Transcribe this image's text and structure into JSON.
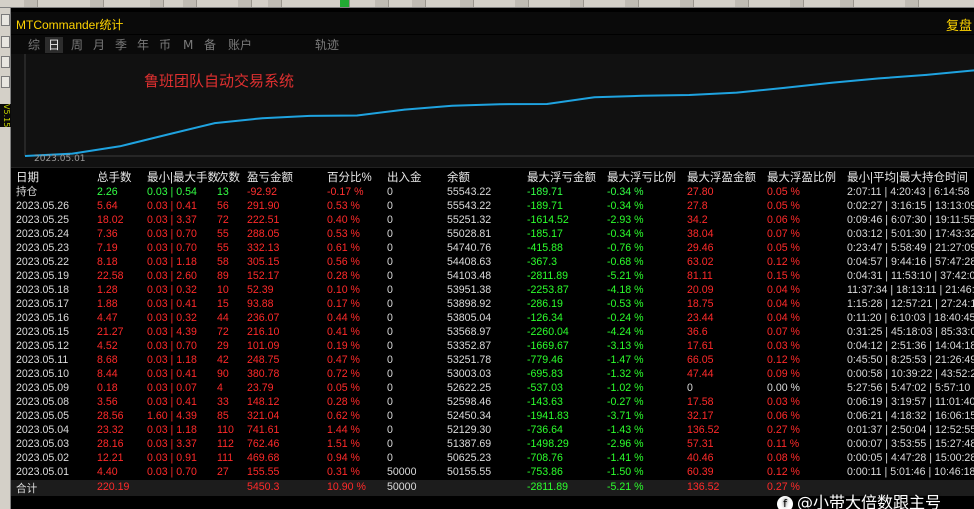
{
  "window": {
    "title": "MTCommander统计",
    "right_button": "复盘",
    "side_label": "V5.15"
  },
  "tabs": [
    {
      "label": "综",
      "active": false
    },
    {
      "label": "日",
      "active": true
    },
    {
      "label": "周",
      "active": false
    },
    {
      "label": "月",
      "active": false
    },
    {
      "label": "季",
      "active": false
    },
    {
      "label": "年",
      "active": false
    },
    {
      "label": "币",
      "active": false
    },
    {
      "label": "M",
      "active": false
    },
    {
      "label": "备",
      "active": false
    },
    {
      "label": "账户",
      "active": false
    },
    {
      "label": "轨迹",
      "active": false
    }
  ],
  "chart": {
    "title": "鲁班团队自动交易系统",
    "start_date": "2023.05.01",
    "line_color": "#1fa3e0",
    "values": [
      50155.55,
      50625.23,
      51387.69,
      52129.3,
      52450.34,
      52598.46,
      52622.25,
      53003.03,
      53251.78,
      53352.87,
      53368.97,
      53805.04,
      53898.92,
      53951.38,
      54103.48,
      54408.63,
      54740.76,
      55028.81,
      55251.32,
      55543.22
    ]
  },
  "table": {
    "headers": [
      "日期",
      "总手数",
      "最小|最大手数",
      "次数",
      "盈亏金额",
      "百分比%",
      "出入金",
      "余额",
      "最大浮亏金额",
      "最大浮亏比例",
      "最大浮盈金额",
      "最大浮盈比例",
      "最小|平均|最大持仓时间"
    ],
    "position": [
      "持仓",
      "2.26",
      "0.03 | 0.54",
      "13",
      "-92.92",
      "-0.17 %",
      "0",
      "55543.22",
      "-189.71",
      "-0.34 %",
      "27.80",
      "0.05 %",
      "2:07:11 | 4:20:43 | 6:14:58"
    ],
    "rows": [
      [
        "2023.05.26",
        "5.64",
        "0.03 | 0.41",
        "56",
        "291.90",
        "0.53 %",
        "0",
        "55543.22",
        "-189.71",
        "-0.34 %",
        "27.8",
        "0.05 %",
        "0:02:27 | 3:16:15 | 13:13:09"
      ],
      [
        "2023.05.25",
        "18.02",
        "0.03 | 3.37",
        "72",
        "222.51",
        "0.40 %",
        "0",
        "55251.32",
        "-1614.52",
        "-2.93 %",
        "34.2",
        "0.06 %",
        "0:09:46 | 6:07:30 | 19:11:55"
      ],
      [
        "2023.05.24",
        "7.36",
        "0.03 | 0.70",
        "55",
        "288.05",
        "0.53 %",
        "0",
        "55028.81",
        "-185.17",
        "-0.34 %",
        "38.04",
        "0.07 %",
        "0:03:12 | 5:01:30 | 17:43:32"
      ],
      [
        "2023.05.23",
        "7.19",
        "0.03 | 0.70",
        "55",
        "332.13",
        "0.61 %",
        "0",
        "54740.76",
        "-415.88",
        "-0.76 %",
        "29.46",
        "0.05 %",
        "0:23:47 | 5:58:49 | 21:27:09"
      ],
      [
        "2023.05.22",
        "8.18",
        "0.03 | 1.18",
        "58",
        "305.15",
        "0.56 %",
        "0",
        "54408.63",
        "-367.3",
        "-0.68 %",
        "63.02",
        "0.12 %",
        "0:04:57 | 9:44:16 | 57:47:28"
      ],
      [
        "2023.05.19",
        "22.58",
        "0.03 | 2.60",
        "89",
        "152.17",
        "0.28 %",
        "0",
        "54103.48",
        "-2811.89",
        "-5.21 %",
        "81.11",
        "0.15 %",
        "0:04:31 | 11:53:10 | 37:42:0"
      ],
      [
        "2023.05.18",
        "1.28",
        "0.03 | 0.32",
        "10",
        "52.39",
        "0.10 %",
        "0",
        "53951.38",
        "-2253.87",
        "-4.18 %",
        "20.09",
        "0.04 %",
        "11:37:34 | 18:13:11 | 21:46:0"
      ],
      [
        "2023.05.17",
        "1.88",
        "0.03 | 0.41",
        "15",
        "93.88",
        "0.17 %",
        "0",
        "53898.92",
        "-286.19",
        "-0.53 %",
        "18.75",
        "0.04 %",
        "1:15:28 | 12:57:21 | 27:24:1"
      ],
      [
        "2023.05.16",
        "4.47",
        "0.03 | 0.32",
        "44",
        "236.07",
        "0.44 %",
        "0",
        "53805.04",
        "-126.34",
        "-0.24 %",
        "23.44",
        "0.04 %",
        "0:11:20 | 6:10:03 | 18:40:45"
      ],
      [
        "2023.05.15",
        "21.27",
        "0.03 | 4.39",
        "72",
        "216.10",
        "0.41 %",
        "0",
        "53568.97",
        "-2260.04",
        "-4.24 %",
        "36.6",
        "0.07 %",
        "0:31:25 | 45:18:03 | 85:33:0"
      ],
      [
        "2023.05.12",
        "4.52",
        "0.03 | 0.70",
        "29",
        "101.09",
        "0.19 %",
        "0",
        "53352.87",
        "-1669.67",
        "-3.13 %",
        "17.61",
        "0.03 %",
        "0:04:12 | 2:51:36 | 14:04:18"
      ],
      [
        "2023.05.11",
        "8.68",
        "0.03 | 1.18",
        "42",
        "248.75",
        "0.47 %",
        "0",
        "53251.78",
        "-779.46",
        "-1.47 %",
        "66.05",
        "0.12 %",
        "0:45:50 | 8:25:53 | 21:26:49"
      ],
      [
        "2023.05.10",
        "8.44",
        "0.03 | 0.41",
        "90",
        "380.78",
        "0.72 %",
        "0",
        "53003.03",
        "-695.83",
        "-1.32 %",
        "47.44",
        "0.09 %",
        "0:00:58 | 10:39:22 | 43:52:2"
      ],
      [
        "2023.05.09",
        "0.18",
        "0.03 | 0.07",
        "4",
        "23.79",
        "0.05 %",
        "0",
        "52622.25",
        "-537.03",
        "-1.02 %",
        "0",
        "0.00 %",
        "5:27:56 | 5:47:02 | 5:57:10"
      ],
      [
        "2023.05.08",
        "3.56",
        "0.03 | 0.41",
        "33",
        "148.12",
        "0.28 %",
        "0",
        "52598.46",
        "-143.63",
        "-0.27 %",
        "17.58",
        "0.03 %",
        "0:06:19 | 3:19:57 | 11:01:40"
      ],
      [
        "2023.05.05",
        "28.56",
        "1.60 | 4.39",
        "85",
        "321.04",
        "0.62 %",
        "0",
        "52450.34",
        "-1941.83",
        "-3.71 %",
        "32.17",
        "0.06 %",
        "0:06:21 | 4:18:32 | 16:06:15"
      ],
      [
        "2023.05.04",
        "23.32",
        "0.03 | 1.18",
        "110",
        "741.61",
        "1.44 %",
        "0",
        "52129.30",
        "-736.64",
        "-1.43 %",
        "136.52",
        "0.27 %",
        "0:01:37 | 2:50:04 | 12:52:55"
      ],
      [
        "2023.05.03",
        "28.16",
        "0.03 | 3.37",
        "112",
        "762.46",
        "1.51 %",
        "0",
        "51387.69",
        "-1498.29",
        "-2.96 %",
        "57.31",
        "0.11 %",
        "0:00:07 | 3:53:55 | 15:27:48"
      ],
      [
        "2023.05.02",
        "12.21",
        "0.03 | 0.91",
        "111",
        "469.68",
        "0.94 %",
        "0",
        "50625.23",
        "-708.76",
        "-1.41 %",
        "40.46",
        "0.08 %",
        "0:00:05 | 4:47:28 | 15:00:28"
      ],
      [
        "2023.05.01",
        "4.40",
        "0.03 | 0.70",
        "27",
        "155.55",
        "0.31 %",
        "50000",
        "50155.55",
        "-753.86",
        "-1.50 %",
        "60.39",
        "0.12 %",
        "0:00:11 | 5:01:46 | 10:46:18"
      ]
    ],
    "total": [
      "合计",
      "220.19",
      "",
      "",
      "5450.3",
      "10.90 %",
      "50000",
      "",
      "-2811.89",
      "-5.21 %",
      "136.52",
      "0.27 %",
      ""
    ]
  },
  "watermark": {
    "text": "@小带大倍数跟主号"
  }
}
